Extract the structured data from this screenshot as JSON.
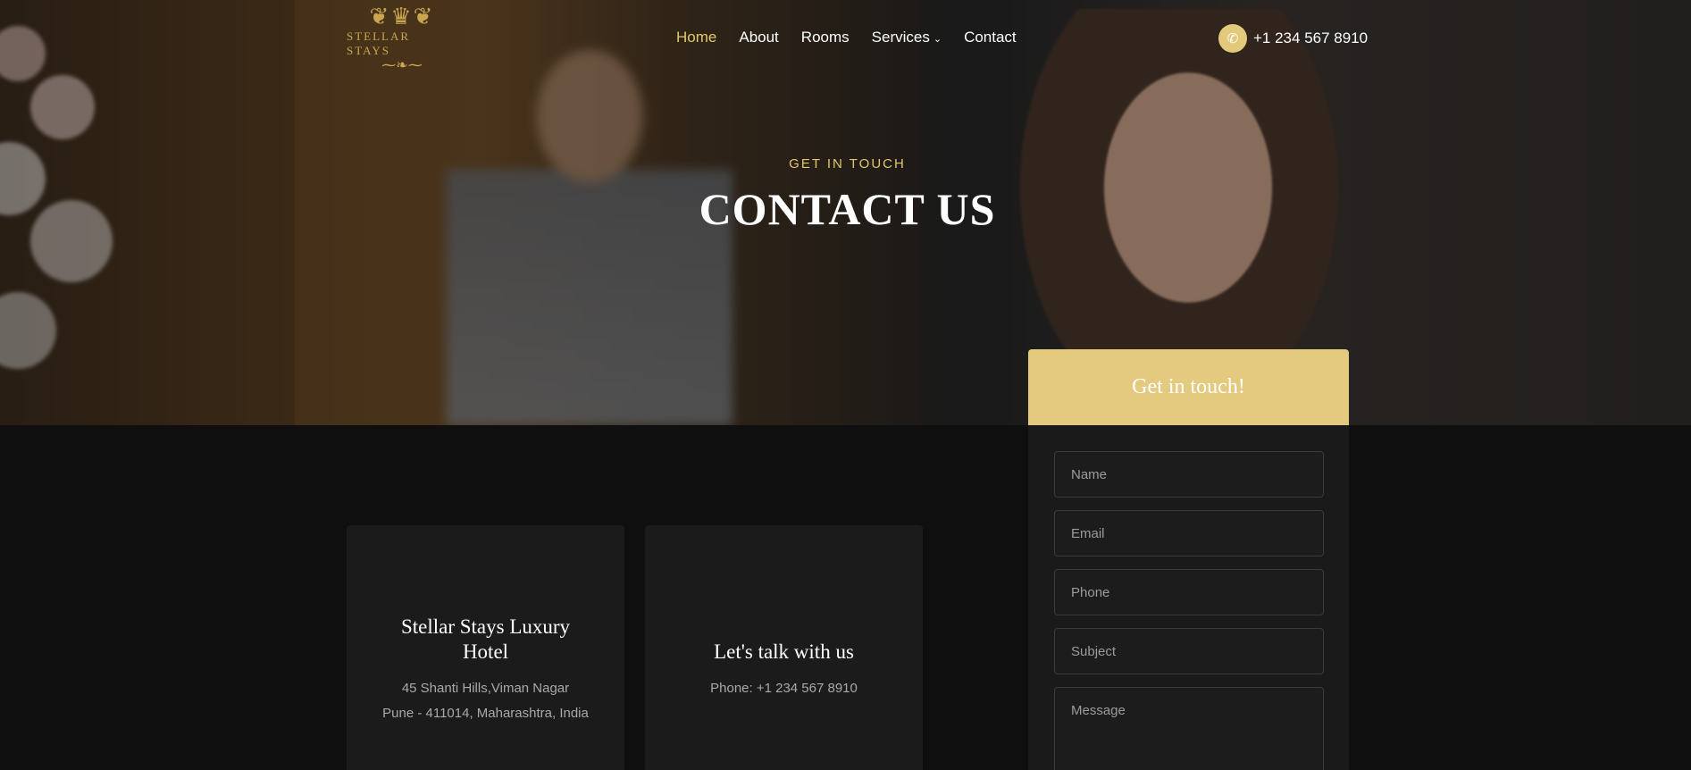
{
  "brand": {
    "logo_text": "STELLAR STAYS"
  },
  "nav": {
    "items": [
      {
        "label": "Home"
      },
      {
        "label": "About"
      },
      {
        "label": "Rooms"
      },
      {
        "label": "Services"
      },
      {
        "label": "Contact"
      }
    ]
  },
  "header": {
    "phone": "+1 234 567 8910"
  },
  "hero": {
    "kicker": "GET IN TOUCH",
    "title": "CONTACT US"
  },
  "cards": [
    {
      "title": "Stellar Stays Luxury Hotel",
      "lines": [
        "45 Shanti Hills,Viman Nagar",
        "Pune - 411014, Maharashtra, India"
      ]
    },
    {
      "title": "Let's talk with us",
      "lines": [
        "Phone: +1 234 567 8910"
      ]
    }
  ],
  "form": {
    "title": "Get in touch!",
    "fields": [
      {
        "placeholder": "Name"
      },
      {
        "placeholder": "Email"
      },
      {
        "placeholder": "Phone"
      },
      {
        "placeholder": "Subject"
      },
      {
        "placeholder": "Message"
      }
    ]
  },
  "colors": {
    "accent": "#e2c76f",
    "background": "#0f0f0f",
    "card": "#1b1b1b"
  },
  "icons": {
    "phone": "phone-icon",
    "services_dropdown": "chevron-down-icon"
  }
}
